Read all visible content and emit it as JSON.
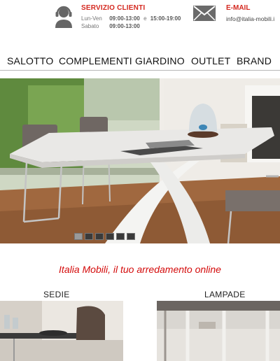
{
  "header": {
    "service": {
      "title": "SERVIZIO CLIENTI",
      "weekday_label": "Lun-Ven",
      "weekday_morning": "09:00-13:00",
      "connector": "e",
      "weekday_afternoon": "15:00-19:00",
      "saturday_label": "Sabato",
      "saturday_hours": "09:00-13:00",
      "icon": "headset-icon"
    },
    "email": {
      "title": "E-MAIL",
      "address": "info@italia-mobili.i",
      "icon": "envelope-icon"
    }
  },
  "nav": {
    "items": [
      {
        "label": "SALOTTO"
      },
      {
        "label": "COMPLEMENTI"
      },
      {
        "label": "GIARDINO"
      },
      {
        "label": "OUTLET"
      },
      {
        "label": "BRAND"
      }
    ]
  },
  "slider": {
    "slide_count": 6,
    "active_index": 0
  },
  "tagline": "Italia Mobili, il tuo arredamento online",
  "categories": [
    {
      "title": "SEDIE"
    },
    {
      "title": "LAMPADE"
    }
  ],
  "colors": {
    "accent_red": "#d4281f",
    "tagline_red": "#d40b0b"
  }
}
